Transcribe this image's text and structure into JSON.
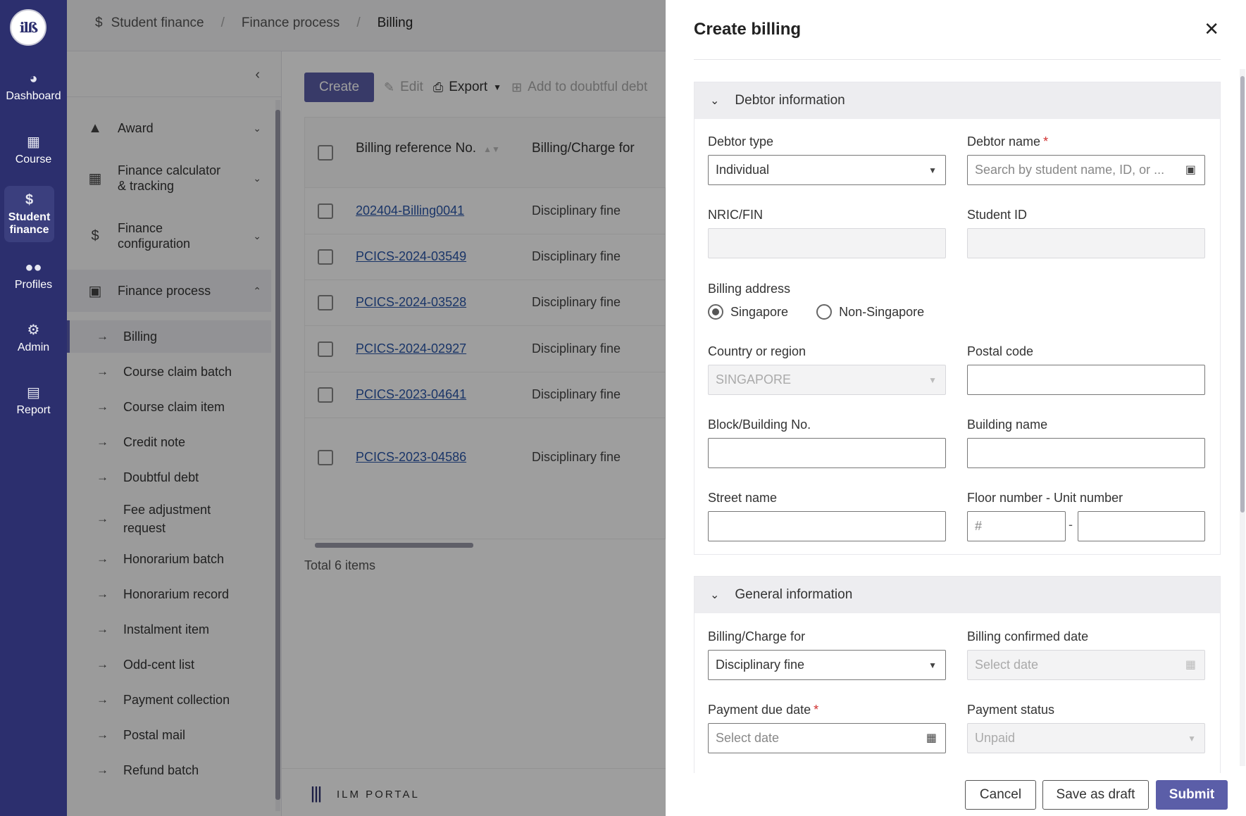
{
  "rail": {
    "logo_text": "ilß",
    "items": [
      {
        "label": "Dashboard",
        "icon": "dashboard-icon"
      },
      {
        "label": "Course",
        "icon": "course-icon"
      },
      {
        "label": "Student finance",
        "icon": "dollar-icon"
      },
      {
        "label": "Profiles",
        "icon": "profiles-icon"
      },
      {
        "label": "Admin",
        "icon": "admin-icon"
      },
      {
        "label": "Report",
        "icon": "report-icon"
      }
    ]
  },
  "breadcrumb": [
    "Student finance",
    "Finance process",
    "Billing"
  ],
  "sidebar": {
    "groups": [
      {
        "label": "Award",
        "icon": "trophy-icon"
      },
      {
        "label": "Finance calculator & tracking",
        "icon": "calculator-icon"
      },
      {
        "label": "Finance configuration",
        "icon": "dollar-icon"
      },
      {
        "label": "Finance process",
        "icon": "money-icon"
      }
    ],
    "sub_items": [
      "Billing",
      "Course claim batch",
      "Course claim item",
      "Credit note",
      "Doubtful debt",
      "Fee adjustment request",
      "Honorarium batch",
      "Honorarium record",
      "Instalment item",
      "Odd-cent list",
      "Payment collection",
      "Postal mail",
      "Refund batch"
    ]
  },
  "toolbar": {
    "create": "Create",
    "edit": "Edit",
    "export": "Export",
    "doubtful": "Add to doubtful debt"
  },
  "table": {
    "col_ref": "Billing reference No.",
    "col_charge": "Billing/Charge for",
    "rows": [
      {
        "ref": "202404-Billing0041",
        "charge": "Disciplinary fine"
      },
      {
        "ref": "PCICS-2024-03549",
        "charge": "Disciplinary fine"
      },
      {
        "ref": "PCICS-2024-03528",
        "charge": "Disciplinary fine"
      },
      {
        "ref": "PCICS-2024-02927",
        "charge": "Disciplinary fine"
      },
      {
        "ref": "PCICS-2023-04641",
        "charge": "Disciplinary fine"
      },
      {
        "ref": "PCICS-2023-04586",
        "charge": "Disciplinary fine"
      }
    ],
    "total": "Total 6 items"
  },
  "footer": {
    "brand": "ILM PORTAL"
  },
  "drawer": {
    "title": "Create billing",
    "debtor_section": "Debtor information",
    "debtor_type_label": "Debtor type",
    "debtor_type_value": "Individual",
    "debtor_name_label": "Debtor name",
    "debtor_name_placeholder": "Search by student name, ID, or ...",
    "nric_label": "NRIC/FIN",
    "student_id_label": "Student ID",
    "billing_address_label": "Billing address",
    "addr_sg": "Singapore",
    "addr_non_sg": "Non-Singapore",
    "country_label": "Country or region",
    "country_value": "SINGAPORE",
    "postal_label": "Postal code",
    "block_label": "Block/Building No.",
    "building_label": "Building name",
    "street_label": "Street name",
    "floor_label": "Floor number - Unit number",
    "floor_prefix": "#",
    "floor_dash": "-",
    "general_section": "General information",
    "charge_label": "Billing/Charge for",
    "charge_value": "Disciplinary fine",
    "confirmed_label": "Billing confirmed date",
    "confirmed_placeholder": "Select date",
    "due_label": "Payment due date",
    "due_placeholder": "Select date",
    "status_label": "Payment status",
    "status_value": "Unpaid",
    "cancel": "Cancel",
    "draft": "Save as draft",
    "submit": "Submit"
  }
}
